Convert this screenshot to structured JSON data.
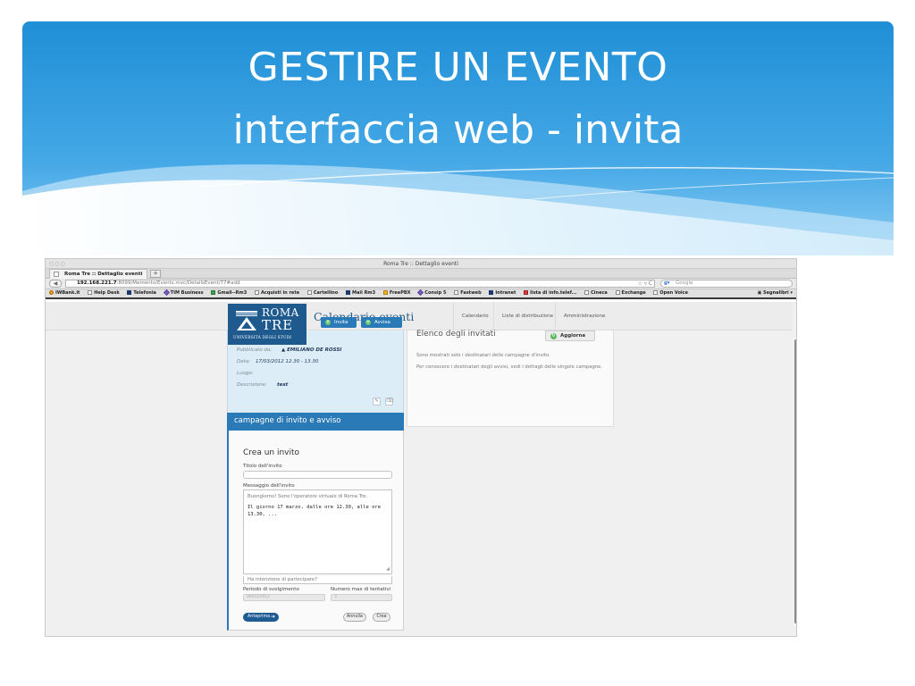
{
  "slide": {
    "title_line1": "GESTIRE UN EVENTO",
    "title_line2": "interfaccia web - invita"
  },
  "browser": {
    "window_title": "Roma Tre :: Dettaglio eventi",
    "tab_label": "Roma Tre :: Dettaglio eventi",
    "url_host": "192.168.221.7",
    "url_rest": ":8099/Memento/Events.mvc/DetailsEvent/77#add",
    "search_placeholder": "Google",
    "bookmarks": [
      "IWBank.it",
      "Help Desk",
      "Telefonia",
      "TIM Business",
      "Gmail--Rm3",
      "Acquisti in rete",
      "Cartellino",
      "Mail Rm3",
      "FreePBX",
      "Consip 5",
      "Fastweb",
      "Intranet",
      "lista di info.telef...",
      "Cineca",
      "Exchange",
      "Open Voice"
    ],
    "bookmarks_menu": "Segnalibri"
  },
  "app": {
    "logo_roma": "ROMA",
    "logo_tre": "TRE",
    "logo_univ": "UNIVERSITÀ DEGLI STUDI",
    "name": "Calendario eventi",
    "nav": {
      "calendario": "Calendario",
      "liste": "Liste di distribuzione",
      "admin": "Amministrazione"
    }
  },
  "event": {
    "pub_label": "Pubblicato da:",
    "pub_value": "EMILIANO DE ROSSI",
    "data_label": "Data:",
    "data_value": "17/03/2012 12.30 - 13.30",
    "luogo_label": "Luogo:",
    "desc_label": "Descrizione:",
    "desc_value": "test"
  },
  "campaigns": {
    "title": "campagne di invito e avviso",
    "invita": "Invita",
    "avvisa": "Avvisa"
  },
  "form": {
    "title": "Crea un invito",
    "titolo_label": "Titolo dell'invito",
    "messaggio_label": "Messaggio dell'invito",
    "greeting": "Buongiorno! Sono l'operatore virtuale di Roma Tre.",
    "message": "Il giorno 17 marzo, dalle ore 12.30, alle ore 13.30, ...",
    "question": "Ha intenzione di partecipare?",
    "periodo_label": "Periodo di svolgimento",
    "periodo_value": "06/03/2012",
    "numero_label": "Numero max di tentativi",
    "numero_value": "3",
    "anteprima": "Anteprima",
    "annulla": "Annulla",
    "crea": "Crea"
  },
  "invitees": {
    "title": "Elenco degli invitati",
    "aggiorna": "Aggiorna",
    "note1": "Sono mostrati solo i destinatari delle campagne d'invito.",
    "note2": "Per conoscere i destinatari degli avvisi, vedi i dettagli delle singole campagne."
  }
}
